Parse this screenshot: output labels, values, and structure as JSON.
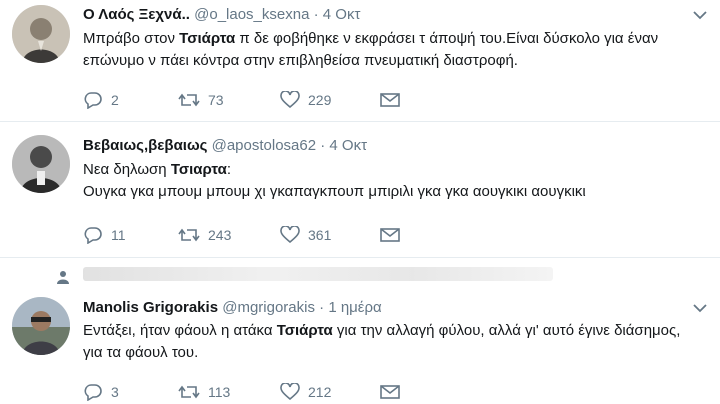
{
  "colors": {
    "text": "#14171a",
    "muted": "#657786",
    "divider": "#e6ecf0"
  },
  "tweets": [
    {
      "name": "Ο Λαός Ξεχνά..",
      "handle": "@o_laos_ksexna",
      "dot": "·",
      "time": "4 Οκτ",
      "text_before": "Μπράβο στον ",
      "text_bold": "Τσιάρτα",
      "text_after": " π δε φοβήθηκε ν εκφράσει τ άποψή του.Είναι δύσκολο για έναν επώνυμο ν πάει κόντρα στην επιβληθείσα πνευματική διαστροφή.",
      "replies": "2",
      "retweets": "73",
      "likes": "229"
    },
    {
      "name": "Βεβαιως,βεβαιως",
      "handle": "@apostolosa62",
      "dot": "·",
      "time": "4 Οκτ",
      "text_before": "Νεα δηλωση ",
      "text_bold": "Τσιαρτα",
      "text_after": ":",
      "text_line2": "Ουγκα γκα μπουμ μπουμ χι γκαπαγκπουπ μπιριλι γκα γκα αουγκικι αουγκικι",
      "replies": "11",
      "retweets": "243",
      "likes": "361"
    },
    {
      "name": "Manolis Grigorakis",
      "handle": "@mgrigorakis",
      "dot": "·",
      "time": "1 ημέρα",
      "text_before": "Εντάξει, ήταν φάουλ η ατάκα ",
      "text_bold": "Τσιάρτα",
      "text_after": " για την αλλαγή φύλου, αλλά γι' αυτό έγινε διάσημος, για τα φάουλ του.",
      "replies": "3",
      "retweets": "113",
      "likes": "212"
    }
  ]
}
